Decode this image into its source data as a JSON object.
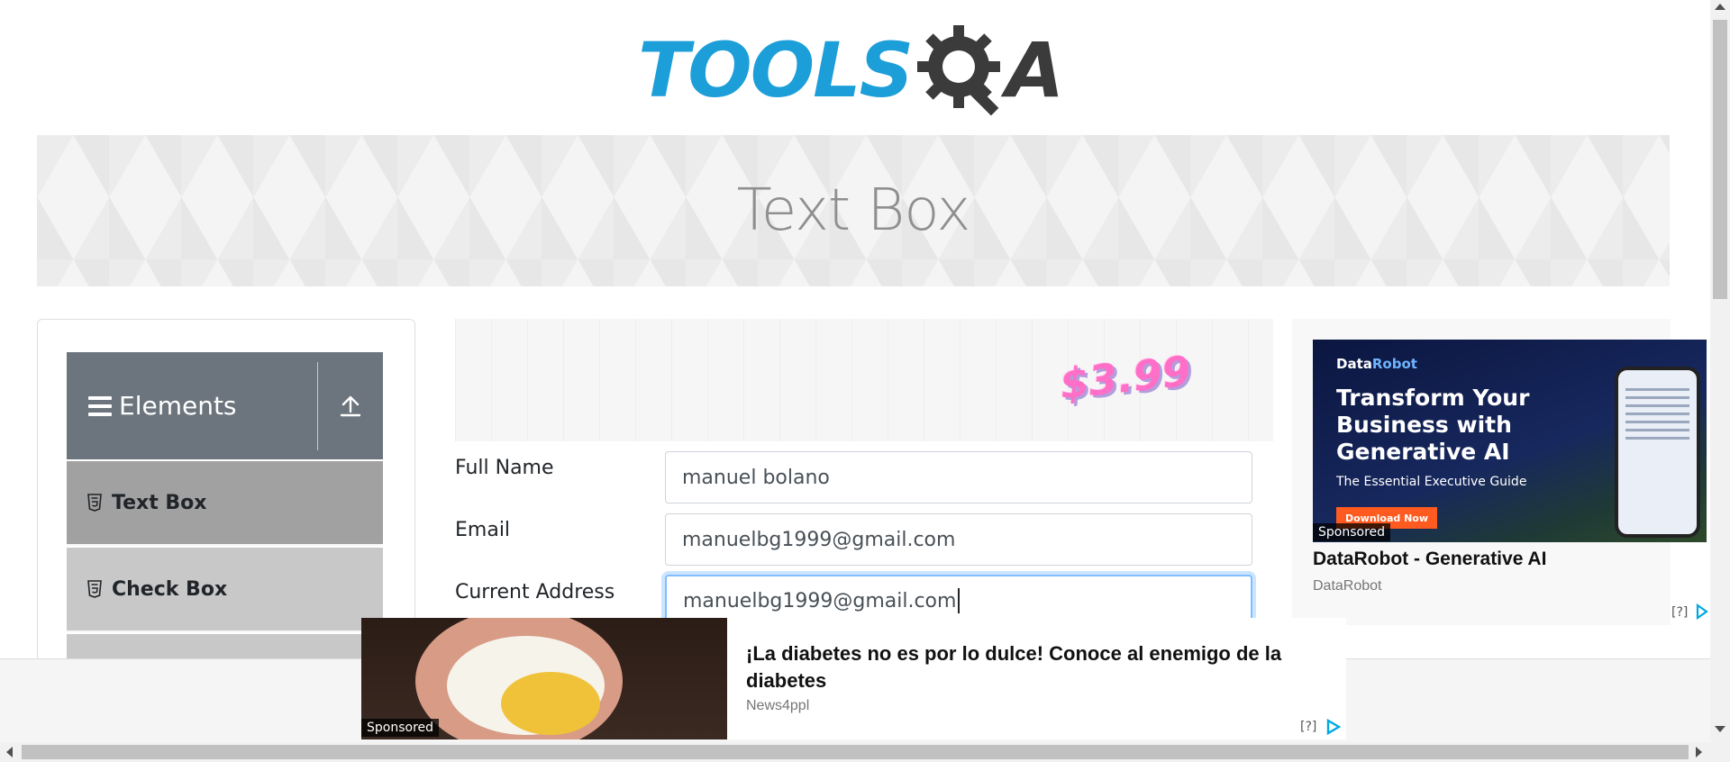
{
  "logo": {
    "text_main": "TOOLS",
    "text_end": "A",
    "icon": "gear-magnifier-icon"
  },
  "page": {
    "title": "Text Box"
  },
  "sidebar": {
    "group": {
      "label": "Elements",
      "icon": "hamburger-icon",
      "toggle_icon": "upload-arrow-icon"
    },
    "items": [
      {
        "label": "Text Box",
        "icon": "html5-icon",
        "active": true
      },
      {
        "label": "Check Box",
        "icon": "html5-icon",
        "active": false
      }
    ]
  },
  "top_ad": {
    "price": "$3.99"
  },
  "form": {
    "full_name": {
      "label": "Full Name",
      "value": "manuel bolano"
    },
    "email": {
      "label": "Email",
      "value": "manuelbg1999@gmail.com"
    },
    "current_address": {
      "label": "Current Address",
      "value": "manuelbg1999@gmail.com"
    }
  },
  "right_ad": {
    "brand_prefix": "Data",
    "brand_suffix": "Robot",
    "headline": "Transform Your Business with Generative AI",
    "subtitle": "The Essential Executive Guide",
    "cta": "Download Now",
    "sponsored": "Sponsored",
    "title": "DataRobot - Generative AI",
    "source": "DataRobot",
    "help": "[?]"
  },
  "bottom_ad": {
    "sponsored": "Sponsored",
    "title": "¡La diabetes no es por lo dulce! Conoce al enemigo de la diabetes",
    "source": "News4ppl",
    "help": "[?]"
  },
  "colors": {
    "brand_blue": "#1c9ed9",
    "sidebar_header": "#6c757d",
    "active_item": "#a1a1a1",
    "focus_border": "#80bdff"
  }
}
